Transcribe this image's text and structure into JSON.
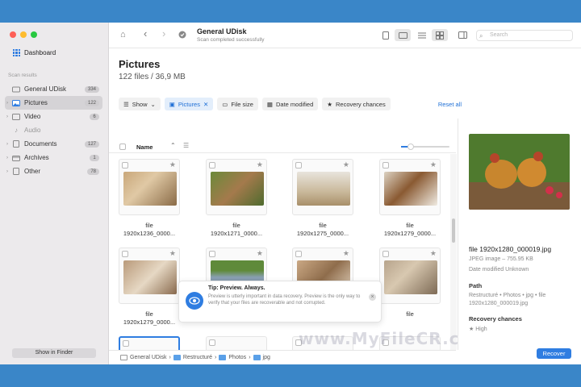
{
  "window": {
    "title": "General UDisk",
    "subtitle": "Scan completed successfully"
  },
  "sidebar": {
    "dashboard": "Dashboard",
    "section": "Scan results",
    "items": [
      {
        "label": "General UDisk",
        "count": "334",
        "icon": "disk-icon"
      },
      {
        "label": "Pictures",
        "count": "122",
        "icon": "picture-icon"
      },
      {
        "label": "Video",
        "count": "6",
        "icon": "video-icon"
      },
      {
        "label": "Audio",
        "count": "",
        "icon": "audio-icon"
      },
      {
        "label": "Documents",
        "count": "127",
        "icon": "document-icon"
      },
      {
        "label": "Archives",
        "count": "1",
        "icon": "archive-icon"
      },
      {
        "label": "Other",
        "count": "78",
        "icon": "other-icon"
      }
    ],
    "show_in_finder": "Show in Finder"
  },
  "search": {
    "placeholder": "Search"
  },
  "main": {
    "title": "Pictures",
    "subtitle": "122 files / 36,9 MB",
    "filters": {
      "show": "Show",
      "pictures": "Pictures",
      "file_size": "File size",
      "date_modified": "Date modified",
      "recovery_chances": "Recovery chances"
    },
    "reset": "Reset all",
    "column_name": "Name"
  },
  "thumbs": [
    {
      "name1": "file",
      "name2": "1920x1236_0000..."
    },
    {
      "name1": "file",
      "name2": "1920x1271_0000..."
    },
    {
      "name1": "file",
      "name2": "1920x1275_0000..."
    },
    {
      "name1": "file",
      "name2": "1920x1279_0000..."
    },
    {
      "name1": "file",
      "name2": "1920x1279_0000..."
    },
    {
      "name1": "",
      "name2": ""
    },
    {
      "name1": "",
      "name2": ""
    },
    {
      "name1": "file",
      "name2": ""
    }
  ],
  "tip": {
    "title": "Tip: Preview. Always.",
    "body": "Preview is utterly important in data recovery. Preview is the only way to verify that your files are recoverable and not corrupted."
  },
  "pathbar": [
    "General UDisk",
    "Restructuré",
    "Photos",
    "jpg"
  ],
  "watermark": "www.MyFileCR.com",
  "preview": {
    "file_name": "file 1920x1280_000019.jpg",
    "type": "JPEG image – 755.95 KB",
    "date": "Date modified  Unknown",
    "path_label": "Path",
    "path": "Restructuré • Photos • jpg • file 1920x1280_000019.jpg",
    "recovery_label": "Recovery chances",
    "recovery_value": "High"
  },
  "recover": "Recover",
  "colors": {
    "accent": "#2f7de1",
    "background": "#3a86c8"
  }
}
